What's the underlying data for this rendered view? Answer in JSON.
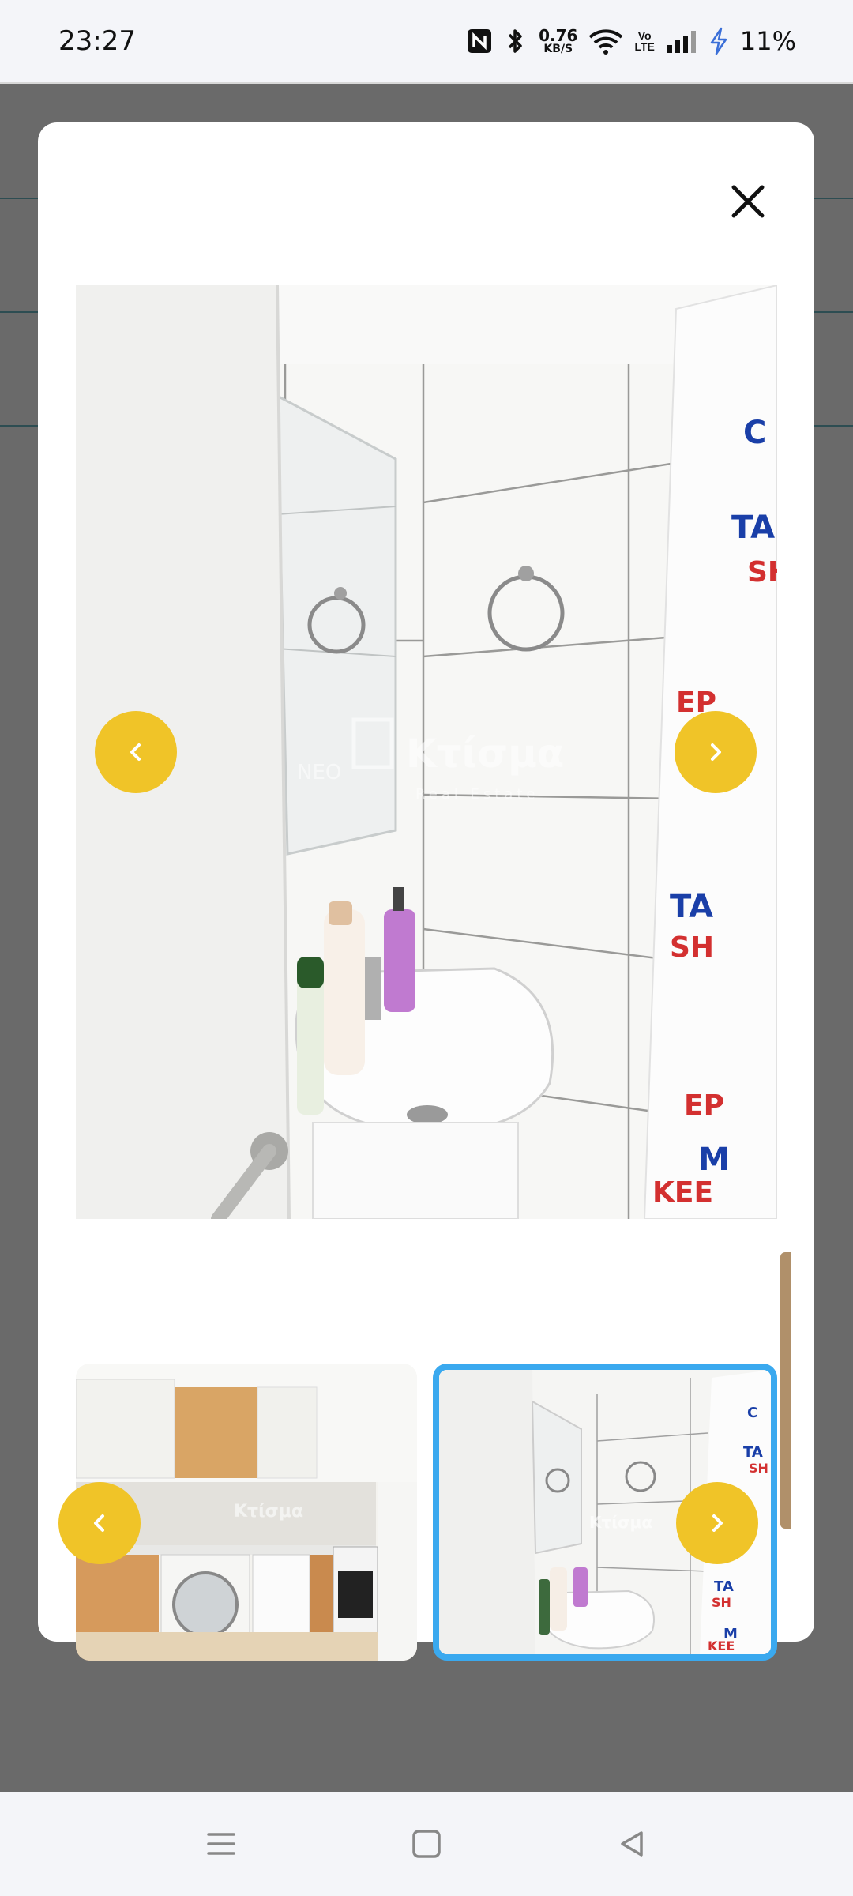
{
  "status_bar": {
    "time": "23:27",
    "net_speed_value": "0.76",
    "net_speed_unit": "KB/S",
    "volte_top": "Vo",
    "volte_bottom": "LTE",
    "battery": "11%",
    "icons": [
      "nfc-icon",
      "bluetooth-icon",
      "wifi-icon",
      "signal-icon",
      "charging-icon"
    ]
  },
  "gallery": {
    "watermark_brand": "Κτίσμα",
    "watermark_prefix": "NEO",
    "watermark_sub": "Real Estate",
    "thumbnail_watermark": "Κτίσμα",
    "selected_thumbnail": 2,
    "thumbnails": [
      {
        "label": "kitchen-photo"
      },
      {
        "label": "bathroom-photo"
      }
    ]
  },
  "colors": {
    "arrow": "#f0c428",
    "selected_border": "#3aa9ef",
    "overlay": "#6a6a6a"
  }
}
